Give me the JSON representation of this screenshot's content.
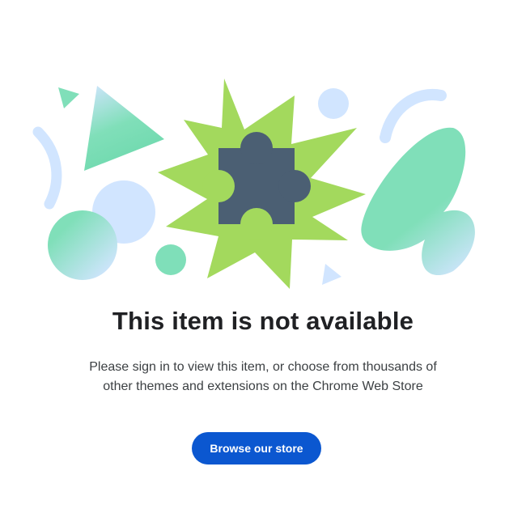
{
  "main": {
    "title": "This item is not available",
    "message_line1": "Please sign in to view this item, or choose from thousands of",
    "message_line2": "other themes and extensions on the Chrome Web Store",
    "browse_button_label": "Browse our store"
  },
  "illustration": {
    "center_icon": "puzzle-piece-icon",
    "colors": {
      "starburst": "#a3d95d",
      "puzzle": "#4b5f73",
      "mint": "#7fdfb9",
      "light_blue": "#d1e5ff",
      "button": "#0b57d0",
      "title_text": "#202124"
    }
  }
}
